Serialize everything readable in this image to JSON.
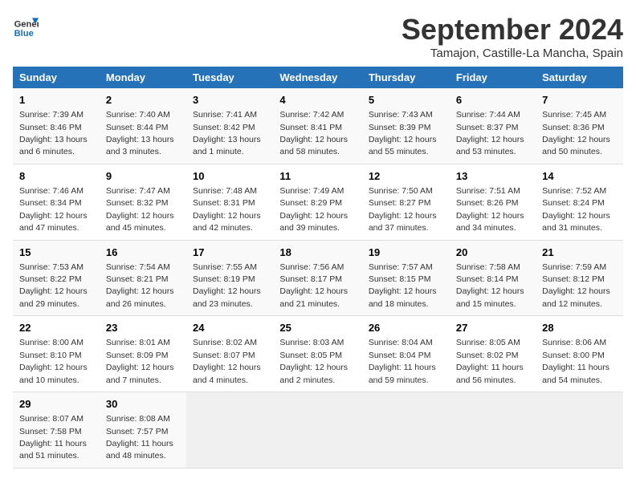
{
  "header": {
    "logo_general": "General",
    "logo_blue": "Blue",
    "title": "September 2024",
    "subtitle": "Tamajon, Castille-La Mancha, Spain"
  },
  "days_of_week": [
    "Sunday",
    "Monday",
    "Tuesday",
    "Wednesday",
    "Thursday",
    "Friday",
    "Saturday"
  ],
  "weeks": [
    [
      {
        "day": "1",
        "sunrise": "Sunrise: 7:39 AM",
        "sunset": "Sunset: 8:46 PM",
        "daylight": "Daylight: 13 hours and 6 minutes."
      },
      {
        "day": "2",
        "sunrise": "Sunrise: 7:40 AM",
        "sunset": "Sunset: 8:44 PM",
        "daylight": "Daylight: 13 hours and 3 minutes."
      },
      {
        "day": "3",
        "sunrise": "Sunrise: 7:41 AM",
        "sunset": "Sunset: 8:42 PM",
        "daylight": "Daylight: 13 hours and 1 minute."
      },
      {
        "day": "4",
        "sunrise": "Sunrise: 7:42 AM",
        "sunset": "Sunset: 8:41 PM",
        "daylight": "Daylight: 12 hours and 58 minutes."
      },
      {
        "day": "5",
        "sunrise": "Sunrise: 7:43 AM",
        "sunset": "Sunset: 8:39 PM",
        "daylight": "Daylight: 12 hours and 55 minutes."
      },
      {
        "day": "6",
        "sunrise": "Sunrise: 7:44 AM",
        "sunset": "Sunset: 8:37 PM",
        "daylight": "Daylight: 12 hours and 53 minutes."
      },
      {
        "day": "7",
        "sunrise": "Sunrise: 7:45 AM",
        "sunset": "Sunset: 8:36 PM",
        "daylight": "Daylight: 12 hours and 50 minutes."
      }
    ],
    [
      {
        "day": "8",
        "sunrise": "Sunrise: 7:46 AM",
        "sunset": "Sunset: 8:34 PM",
        "daylight": "Daylight: 12 hours and 47 minutes."
      },
      {
        "day": "9",
        "sunrise": "Sunrise: 7:47 AM",
        "sunset": "Sunset: 8:32 PM",
        "daylight": "Daylight: 12 hours and 45 minutes."
      },
      {
        "day": "10",
        "sunrise": "Sunrise: 7:48 AM",
        "sunset": "Sunset: 8:31 PM",
        "daylight": "Daylight: 12 hours and 42 minutes."
      },
      {
        "day": "11",
        "sunrise": "Sunrise: 7:49 AM",
        "sunset": "Sunset: 8:29 PM",
        "daylight": "Daylight: 12 hours and 39 minutes."
      },
      {
        "day": "12",
        "sunrise": "Sunrise: 7:50 AM",
        "sunset": "Sunset: 8:27 PM",
        "daylight": "Daylight: 12 hours and 37 minutes."
      },
      {
        "day": "13",
        "sunrise": "Sunrise: 7:51 AM",
        "sunset": "Sunset: 8:26 PM",
        "daylight": "Daylight: 12 hours and 34 minutes."
      },
      {
        "day": "14",
        "sunrise": "Sunrise: 7:52 AM",
        "sunset": "Sunset: 8:24 PM",
        "daylight": "Daylight: 12 hours and 31 minutes."
      }
    ],
    [
      {
        "day": "15",
        "sunrise": "Sunrise: 7:53 AM",
        "sunset": "Sunset: 8:22 PM",
        "daylight": "Daylight: 12 hours and 29 minutes."
      },
      {
        "day": "16",
        "sunrise": "Sunrise: 7:54 AM",
        "sunset": "Sunset: 8:21 PM",
        "daylight": "Daylight: 12 hours and 26 minutes."
      },
      {
        "day": "17",
        "sunrise": "Sunrise: 7:55 AM",
        "sunset": "Sunset: 8:19 PM",
        "daylight": "Daylight: 12 hours and 23 minutes."
      },
      {
        "day": "18",
        "sunrise": "Sunrise: 7:56 AM",
        "sunset": "Sunset: 8:17 PM",
        "daylight": "Daylight: 12 hours and 21 minutes."
      },
      {
        "day": "19",
        "sunrise": "Sunrise: 7:57 AM",
        "sunset": "Sunset: 8:15 PM",
        "daylight": "Daylight: 12 hours and 18 minutes."
      },
      {
        "day": "20",
        "sunrise": "Sunrise: 7:58 AM",
        "sunset": "Sunset: 8:14 PM",
        "daylight": "Daylight: 12 hours and 15 minutes."
      },
      {
        "day": "21",
        "sunrise": "Sunrise: 7:59 AM",
        "sunset": "Sunset: 8:12 PM",
        "daylight": "Daylight: 12 hours and 12 minutes."
      }
    ],
    [
      {
        "day": "22",
        "sunrise": "Sunrise: 8:00 AM",
        "sunset": "Sunset: 8:10 PM",
        "daylight": "Daylight: 12 hours and 10 minutes."
      },
      {
        "day": "23",
        "sunrise": "Sunrise: 8:01 AM",
        "sunset": "Sunset: 8:09 PM",
        "daylight": "Daylight: 12 hours and 7 minutes."
      },
      {
        "day": "24",
        "sunrise": "Sunrise: 8:02 AM",
        "sunset": "Sunset: 8:07 PM",
        "daylight": "Daylight: 12 hours and 4 minutes."
      },
      {
        "day": "25",
        "sunrise": "Sunrise: 8:03 AM",
        "sunset": "Sunset: 8:05 PM",
        "daylight": "Daylight: 12 hours and 2 minutes."
      },
      {
        "day": "26",
        "sunrise": "Sunrise: 8:04 AM",
        "sunset": "Sunset: 8:04 PM",
        "daylight": "Daylight: 11 hours and 59 minutes."
      },
      {
        "day": "27",
        "sunrise": "Sunrise: 8:05 AM",
        "sunset": "Sunset: 8:02 PM",
        "daylight": "Daylight: 11 hours and 56 minutes."
      },
      {
        "day": "28",
        "sunrise": "Sunrise: 8:06 AM",
        "sunset": "Sunset: 8:00 PM",
        "daylight": "Daylight: 11 hours and 54 minutes."
      }
    ],
    [
      {
        "day": "29",
        "sunrise": "Sunrise: 8:07 AM",
        "sunset": "Sunset: 7:58 PM",
        "daylight": "Daylight: 11 hours and 51 minutes."
      },
      {
        "day": "30",
        "sunrise": "Sunrise: 8:08 AM",
        "sunset": "Sunset: 7:57 PM",
        "daylight": "Daylight: 11 hours and 48 minutes."
      },
      null,
      null,
      null,
      null,
      null
    ]
  ]
}
